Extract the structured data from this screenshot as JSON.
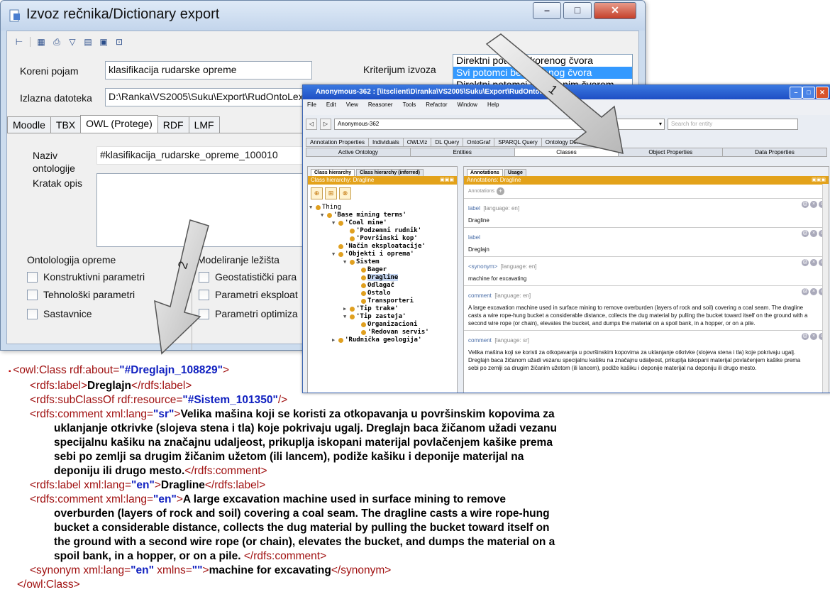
{
  "export_window": {
    "title": "Izvoz rečnika/Dictionary export",
    "root_concept_label": "Koreni pojam",
    "root_concept_value": "klasifikacija rudarske opreme",
    "output_file_label": "Izlazna datoteka",
    "output_file_value": "D:\\Ranka\\VS2005\\Suku\\Export\\RudOntoLex",
    "criterion_label": "Kriterijum izvoza",
    "criterion_options": [
      "Direktni potomci korenog čvora",
      "Svi potomci bez korenog čvora",
      "Direktni potomci sa korenim čvorom"
    ],
    "tabs": [
      "Moodle",
      "TBX",
      "OWL (Protege)",
      "RDF",
      "LMF"
    ],
    "ontology_name_label": "Naziv ontologije",
    "ontology_name_value": "#klasifikacija_rudarske_opreme_100010",
    "short_desc_label": "Kratak opis",
    "group1_title": "Ontolologija opreme",
    "group1_items": [
      "Konstruktivni parametri",
      "Tehnološki parametri",
      "Sastavnice"
    ],
    "group2_title": "Modeliranje ležišta",
    "group2_items": [
      "Geostatistički para",
      "Parametri eksploat",
      "Parametri optimiza"
    ]
  },
  "protege": {
    "title": "Anonymous-362 : [\\\\tsclient\\D\\ranka\\VS2005\\Suku\\Export\\RudOntoLex.owl]",
    "menu": [
      "File",
      "Edit",
      "View",
      "Reasoner",
      "Tools",
      "Refactor",
      "Window",
      "Help"
    ],
    "entity": "Anonymous-362",
    "search_placeholder": "Search for entity",
    "tabs_row1": [
      "Annotation Properties",
      "Individuals",
      "OWLViz",
      "DL Query",
      "OntoGraf",
      "SPARQL Query",
      "Ontology Differences"
    ],
    "tabs_row2": [
      "Active Ontology",
      "Entities",
      "Classes",
      "Object Properties",
      "Data Properties"
    ],
    "left_tabs": [
      "Class hierarchy",
      "Class hierarchy (inferred)"
    ],
    "left_header": "Class hierarchy: Dragline",
    "tree": [
      "Thing",
      "'Base mining terms'",
      "'Coal mine'",
      "'Podzemni rudnik'",
      "'Površinski kop'",
      "'Način eksploatacije'",
      "'Objekti i oprema'",
      "Sistem",
      "Bager",
      "Dragline",
      "Odlagač",
      "Ostalo",
      "Transporteri",
      "'Tip trake'",
      "'Tip zasteja'",
      "Organizacioni",
      "'Redovan servis'",
      "'Rudnička geologija'"
    ],
    "right_tabs": [
      "Annotations",
      "Usage"
    ],
    "right_header": "Annotations: Dragline",
    "annotations_label": "Annotations",
    "annotations": [
      {
        "prop": "label",
        "lang": "[language: en]",
        "value": "Dragline"
      },
      {
        "prop": "label",
        "lang": "",
        "value": "Dreglajn"
      },
      {
        "prop": "<synonym>",
        "lang": "[language: en]",
        "value": "machine for excavating"
      },
      {
        "prop": "comment",
        "lang": "[language: en]",
        "value": "A large excavation machine used in surface mining to remove overburden (layers of rock and soil) covering a coal seam. The dragline casts a wire rope-hung bucket a considerable distance, collects the dug material by pulling the bucket toward itself on the ground with a second wire rope (or chain), elevates the bucket, and dumps the material on a spoil bank, in a hopper, or on a pile."
      },
      {
        "prop": "comment",
        "lang": "[language: sr]",
        "value": "Velika mašina koji se koristi za otkopavanja u površinskim kopovima za uklanjanje otkrivke (slojeva stena i tla) koje pokrivaju ugalj. Dreglajn baca žičanom užadi vezanu specijalnu kašiku na značajnu udaljeost, prikuplja iskopani materijal povlačenjem kašike prema sebi po zemlji sa drugim žičanim užetom (ili lancem), podiže kašiku i deponije materijal na deponiju ili drugo mesto."
      }
    ]
  },
  "arrow_labels": [
    "1",
    "2"
  ],
  "xml": {
    "open_tag": "<owl:Class",
    "about_attr": "rdf:about=",
    "about_val": "\"#Dreglajn_108829\"",
    "gt": ">",
    "l1_open": "<rdfs:label>",
    "l1_text": "Dreglajn",
    "l1_close": "</rdfs:label>",
    "l2_open": "<rdfs:subClassOf rdf:resource=",
    "l2_val": "\"#Sistem_101350\"",
    "l2_close": "/>",
    "l3_open": "<rdfs:comment xml:lang=",
    "l3_lang": "\"sr\"",
    "l3_gt": ">",
    "l3_text": [
      "Velika mašina koji se koristi za otkopavanja u površinskim kopovima za",
      "uklanjanje otkrivke (slojeva stena i tla) koje pokrivaju ugalj. Dreglajn baca žičanom užadi vezanu",
      "specijalnu kašiku na značajnu udaljeost, prikuplja iskopani materijal povlačenjem kašike prema",
      "sebi po zemlji sa drugim žičanim užetom (ili lancem), podiže kašiku i deponije materijal na",
      "deponiju ili drugo mesto."
    ],
    "l3_close": "</rdfs:comment>",
    "l4_open": "<rdfs:label xml:lang=",
    "l4_lang": "\"en\"",
    "l4_gt": ">",
    "l4_text": "Dragline",
    "l4_close": "</rdfs:label>",
    "l5_open": "<rdfs:comment xml:lang=",
    "l5_lang": "\"en\"",
    "l5_gt": ">",
    "l5_text": [
      "A large excavation machine used in surface mining to remove",
      "overburden (layers of rock and soil) covering a coal seam. The dragline casts a wire rope-hung",
      "bucket a considerable distance, collects the dug material by pulling the bucket toward itself on",
      "the ground with a second wire rope (or chain), elevates the bucket, and dumps the material on a",
      "spoil bank, in a hopper, or on a pile. "
    ],
    "l5_close": "</rdfs:comment>",
    "l6_open": "<synonym xml:lang=",
    "l6_lang": "\"en\"",
    "l6_xmlns": " xmlns=",
    "l6_xmlns_val": "\"\"",
    "l6_gt": ">",
    "l6_text": "machine for excavating",
    "l6_close": "</synonym>",
    "close_tag": "</owl:Class>"
  }
}
